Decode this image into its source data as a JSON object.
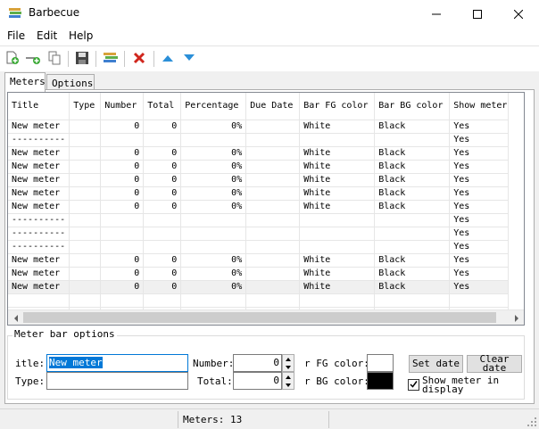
{
  "window": {
    "title": "Barbecue",
    "icon": "barbecue-app-icon",
    "controls": [
      "minimize-icon",
      "maximize-icon",
      "close-icon"
    ]
  },
  "menu": {
    "items": [
      "File",
      "Edit",
      "Help"
    ]
  },
  "toolbar": {
    "buttons": [
      {
        "name": "new-meter",
        "icon": "add-document-icon"
      },
      {
        "name": "new-separator",
        "icon": "add-separator-icon"
      },
      {
        "name": "duplicate",
        "icon": "copy-icon"
      },
      {
        "name": "save",
        "icon": "floppy-disk-icon"
      },
      {
        "name": "show-meters",
        "icon": "barbecue-stack-icon"
      },
      {
        "name": "delete",
        "icon": "red-x-icon"
      },
      {
        "name": "move-up",
        "icon": "up-triangle-icon"
      },
      {
        "name": "move-down",
        "icon": "down-triangle-icon"
      }
    ]
  },
  "tabs": [
    "Meters",
    "Options"
  ],
  "table": {
    "columns": [
      "Title",
      "Type",
      "Number",
      "Total",
      "Percentage",
      "Due Date",
      "Bar FG color",
      "Bar BG color",
      "Show meter"
    ],
    "rows": [
      [
        "New meter",
        "",
        "0",
        "0",
        "0%",
        "",
        "White",
        "Black",
        "Yes"
      ],
      [
        "----------",
        "",
        "",
        "",
        "",
        "",
        "",
        "",
        "Yes"
      ],
      [
        "New meter",
        "",
        "0",
        "0",
        "0%",
        "",
        "White",
        "Black",
        "Yes"
      ],
      [
        "New meter",
        "",
        "0",
        "0",
        "0%",
        "",
        "White",
        "Black",
        "Yes"
      ],
      [
        "New meter",
        "",
        "0",
        "0",
        "0%",
        "",
        "White",
        "Black",
        "Yes"
      ],
      [
        "New meter",
        "",
        "0",
        "0",
        "0%",
        "",
        "White",
        "Black",
        "Yes"
      ],
      [
        "New meter",
        "",
        "0",
        "0",
        "0%",
        "",
        "White",
        "Black",
        "Yes"
      ],
      [
        "----------",
        "",
        "",
        "",
        "",
        "",
        "",
        "",
        "Yes"
      ],
      [
        "----------",
        "",
        "",
        "",
        "",
        "",
        "",
        "",
        "Yes"
      ],
      [
        "----------",
        "",
        "",
        "",
        "",
        "",
        "",
        "",
        "Yes"
      ],
      [
        "New meter",
        "",
        "0",
        "0",
        "0%",
        "",
        "White",
        "Black",
        "Yes"
      ],
      [
        "New meter",
        "",
        "0",
        "0",
        "0%",
        "",
        "White",
        "Black",
        "Yes"
      ],
      [
        "New meter",
        "",
        "0",
        "0",
        "0%",
        "",
        "White",
        "Black",
        "Yes"
      ]
    ],
    "selected_row": 12
  },
  "options": {
    "group_label": "Meter bar options",
    "title_label": "itle:",
    "title_value": "New meter",
    "type_label": "Type:",
    "type_value": "",
    "number_label": "Number:",
    "number_value": "0",
    "total_label": "Total:",
    "total_value": "0",
    "fg_label": "r FG color:",
    "fg_color": "#ffffff",
    "bg_label": "r BG color:",
    "bg_color": "#000000",
    "set_date": "Set date",
    "clear_date": "Clear date",
    "show_meter_label": "Show meter in display",
    "show_meter_checked": true
  },
  "status": {
    "text": "Meters: 13"
  },
  "colors": {
    "selection": "#0078d7",
    "window_bg": "#f0f0f0"
  }
}
